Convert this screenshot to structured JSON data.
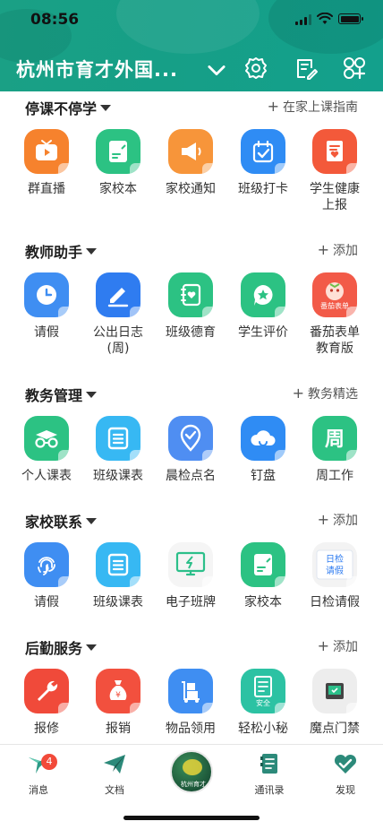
{
  "status": {
    "time": "08:56"
  },
  "header": {
    "school_name": "杭州市育才外国..."
  },
  "sections": [
    {
      "title": "停课不停学",
      "action": "在家上课指南",
      "items": [
        {
          "label": "群直播",
          "icon": "tv-icon",
          "color": "#f6822d"
        },
        {
          "label": "家校本",
          "icon": "note-icon",
          "color": "#2cc283"
        },
        {
          "label": "家校通知",
          "icon": "megaphone-icon",
          "color": "#f7953a"
        },
        {
          "label": "班级打卡",
          "icon": "calendar-check-icon",
          "color": "#2f8cf4"
        },
        {
          "label": "学生健康上报",
          "icon": "health-form-icon",
          "color": "#f3593a"
        }
      ]
    },
    {
      "title": "教师助手",
      "action": "添加",
      "items": [
        {
          "label": "请假",
          "icon": "clock-icon",
          "color": "#3f8ef2"
        },
        {
          "label": "公出日志(周)",
          "icon": "pen-icon",
          "color": "#2f7cf0"
        },
        {
          "label": "班级德育",
          "icon": "notebook-heart-icon",
          "color": "#2cc283"
        },
        {
          "label": "学生评价",
          "icon": "star-bubble-icon",
          "color": "#2cc283"
        },
        {
          "label": "番茄表单教育版",
          "icon": "tomato-form-icon",
          "color": "#f25a48",
          "sub": "番茄表单"
        }
      ]
    },
    {
      "title": "教务管理",
      "action": "教务精选",
      "items": [
        {
          "label": "个人课表",
          "icon": "glasses-icon",
          "color": "#2cc283"
        },
        {
          "label": "班级课表",
          "icon": "list-icon",
          "color": "#37b8f3"
        },
        {
          "label": "晨检点名",
          "icon": "location-check-icon",
          "color": "#4f8ef2"
        },
        {
          "label": "钉盘",
          "icon": "cloud-icon",
          "color": "#2f8cf4"
        },
        {
          "label": "周工作",
          "icon": "week-icon",
          "color": "#2cc283",
          "glyph": "周"
        }
      ]
    },
    {
      "title": "家校联系",
      "action": "添加",
      "items": [
        {
          "label": "请假",
          "icon": "fingerprint-icon",
          "color": "#3f8ef2"
        },
        {
          "label": "班级课表",
          "icon": "list-icon",
          "color": "#37b8f3"
        },
        {
          "label": "电子班牌",
          "icon": "monitor-icon",
          "color": "#f5f5f5"
        },
        {
          "label": "家校本",
          "icon": "note-icon",
          "color": "#2cc283"
        },
        {
          "label": "日检请假",
          "icon": "daily-check-icon",
          "color": "#f3f3f3",
          "glyph": "日检\n请假"
        }
      ]
    },
    {
      "title": "后勤服务",
      "action": "添加",
      "items": [
        {
          "label": "报修",
          "icon": "wrench-icon",
          "color": "#f04a3a"
        },
        {
          "label": "报销",
          "icon": "money-bag-icon",
          "color": "#f2503e"
        },
        {
          "label": "物品领用",
          "icon": "cart-icon",
          "color": "#3f8ef2"
        },
        {
          "label": "轻松小秘",
          "icon": "clipboard-icon",
          "color": "#2cc2a3",
          "sub": "安全"
        },
        {
          "label": "魔点门禁",
          "icon": "door-icon",
          "color": "#ededed"
        }
      ]
    }
  ],
  "tabbar": [
    {
      "label": "消息",
      "icon": "message-bird-icon",
      "badge": "4"
    },
    {
      "label": "文档",
      "icon": "paper-plane-icon"
    },
    {
      "label": "杭州育才",
      "icon": "school-logo-icon"
    },
    {
      "label": "通讯录",
      "icon": "contacts-icon"
    },
    {
      "label": "发现",
      "icon": "heart-discover-icon"
    }
  ]
}
